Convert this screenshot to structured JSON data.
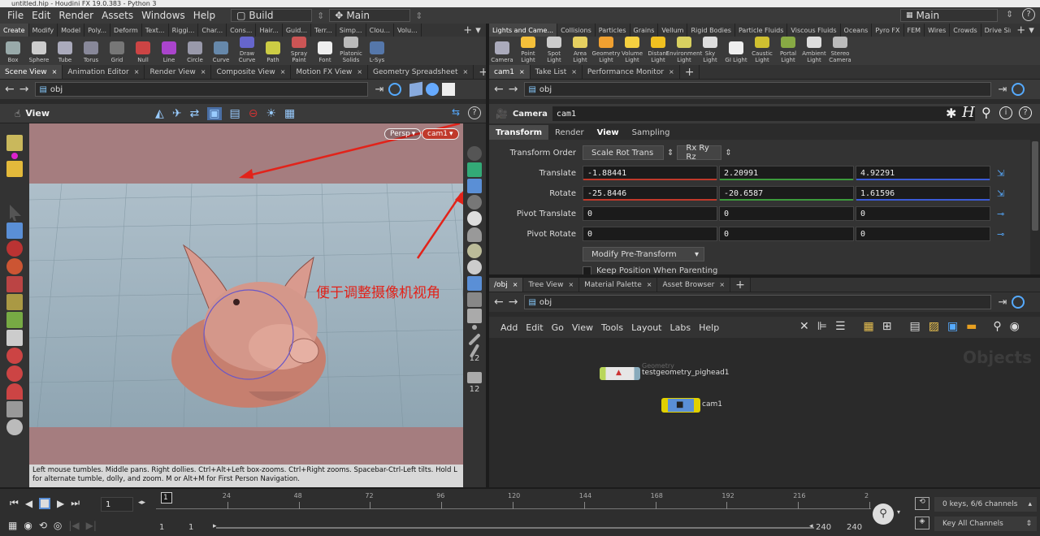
{
  "window": {
    "title": "untitled.hip - Houdini FX 19.0.383 - Python 3"
  },
  "menu": {
    "items": [
      "File",
      "Edit",
      "Render",
      "Assets",
      "Windows",
      "Help"
    ],
    "desktop": "Build",
    "context": "Main",
    "right_desktop": "Main"
  },
  "shelf_left": {
    "tabs": [
      "Create",
      "Modify",
      "Model",
      "Poly...",
      "Deform",
      "Text...",
      "Riggi...",
      "Char...",
      "Cons...",
      "Hair...",
      "Guid...",
      "Terr...",
      "Simp...",
      "Clou...",
      "Volu..."
    ],
    "tools": [
      "Box",
      "Sphere",
      "Tube",
      "Torus",
      "Grid",
      "Null",
      "Line",
      "Circle",
      "Curve",
      "Draw Curve",
      "Path",
      "Spray Paint",
      "Font",
      "Platonic Solids",
      "L-Sys"
    ]
  },
  "shelf_right": {
    "tabs": [
      "Lights and Came...",
      "Collisions",
      "Particles",
      "Grains",
      "Vellum",
      "Rigid Bodies",
      "Particle Fluids",
      "Viscous Fluids",
      "Oceans",
      "Pyro FX",
      "FEM",
      "Wires",
      "Crowds",
      "Drive Simulation"
    ],
    "tools": [
      "Camera",
      "Point Light",
      "Spot Light",
      "Area Light",
      "Geometry Light",
      "Volume Light",
      "Distant Light",
      "Environment Light",
      "Sky Light",
      "GI Light",
      "Caustic Light",
      "Portal Light",
      "Ambient Light",
      "Stereo Camera"
    ]
  },
  "left_panel": {
    "tabs": [
      "Scene View",
      "Animation Editor",
      "Render View",
      "Composite View",
      "Motion FX View",
      "Geometry Spreadsheet"
    ],
    "path": "obj",
    "viewer_title": "View",
    "persp": "Persp",
    "cam": "cam1",
    "hint": "Left mouse tumbles. Middle pans. Right dollies. Ctrl+Alt+Left box-zooms. Ctrl+Right zooms. Spacebar-Ctrl-Left tilts. Hold L for alternate tumble, dolly, and zoom.   M or Alt+M for First Person Navigation.",
    "annotation": "便于调整摄像机视角"
  },
  "param_panel": {
    "tabs": [
      "cam1",
      "Take List",
      "Performance Monitor"
    ],
    "path": "obj",
    "node_type": "Camera",
    "node_name": "cam1",
    "subtabs": [
      "Transform",
      "Render",
      "View",
      "Sampling"
    ],
    "transform_order_label": "Transform Order",
    "transform_order": "Scale Rot Trans",
    "rot_order": "Rx Ry Rz",
    "rows": [
      {
        "label": "Translate",
        "values": [
          "-1.88441",
          "2.20991",
          "4.92291"
        ]
      },
      {
        "label": "Rotate",
        "values": [
          "-25.8446",
          "-20.6587",
          "1.61596"
        ]
      },
      {
        "label": "Pivot Translate",
        "values": [
          "0",
          "0",
          "0"
        ]
      },
      {
        "label": "Pivot Rotate",
        "values": [
          "0",
          "0",
          "0"
        ]
      }
    ],
    "modify_btn": "Modify Pre-Transform",
    "keep_pos": "Keep Position When Parenting"
  },
  "network_panel": {
    "tabs": [
      "/obj",
      "Tree View",
      "Material Palette",
      "Asset Browser"
    ],
    "path": "obj",
    "menu": [
      "Add",
      "Edit",
      "Go",
      "View",
      "Tools",
      "Layout",
      "Labs",
      "Help"
    ],
    "context_label": "Objects",
    "nodes": [
      {
        "type": "Geometry",
        "name": "testgeometry_pighead1"
      },
      {
        "type": "",
        "name": "cam1"
      }
    ]
  },
  "timeline": {
    "frame": "1",
    "ticks": [
      "24",
      "48",
      "72",
      "96",
      "120",
      "144",
      "168",
      "192",
      "216",
      "2"
    ],
    "start_marker": "1",
    "range_start": "1",
    "range_start2": "1",
    "range_end": "240",
    "range_end2": "240",
    "keys_info": "0 keys, 6/6 channels",
    "key_all": "Key All Channels"
  },
  "colors": {
    "accent_red": "#e2231a",
    "bg": "#2b2b2b",
    "viewport_sky": "#a57d7f",
    "viewport_grid": "#9fb6c4"
  }
}
